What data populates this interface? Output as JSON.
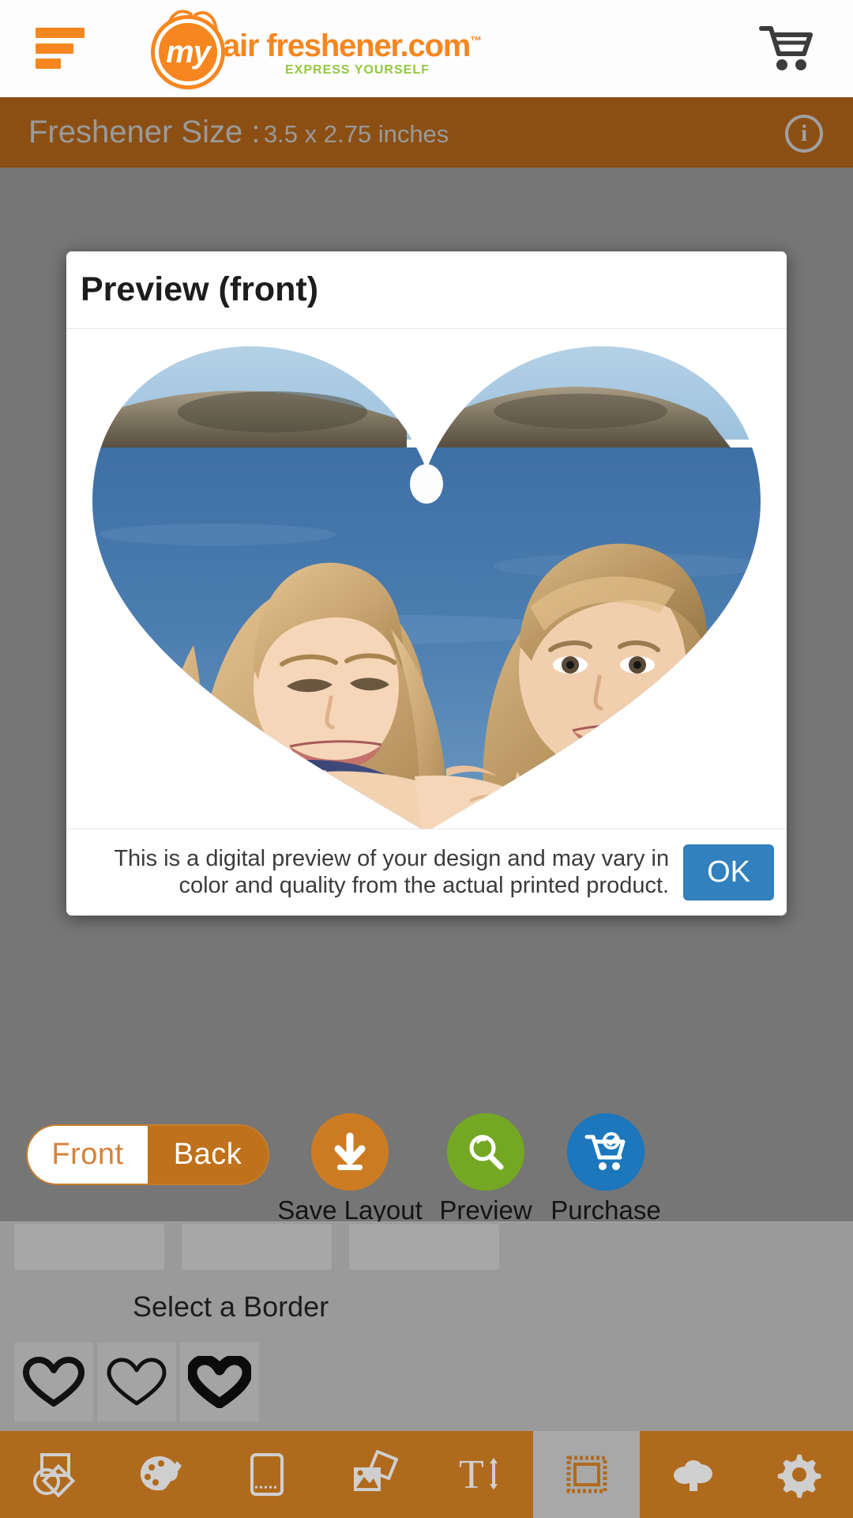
{
  "header": {
    "menu_icon": "hamburger-menu-icon",
    "logo_badge_text": "my",
    "logo_main_text": "air freshener.com",
    "logo_tm": "™",
    "logo_tagline": "EXPRESS YOURSELF",
    "cart_icon": "shopping-cart-icon",
    "brand_orange": "#f6861f",
    "tagline_green": "#93c83e"
  },
  "size_bar": {
    "label": "Freshener Size :",
    "value": "3.5 x 2.75 inches",
    "info_icon": "info-circle-icon",
    "info_glyph": "i",
    "background": "#8b4f14",
    "text_color": "#9a9a9a"
  },
  "modal": {
    "title": "Preview (front)",
    "disclaimer": "This is a digital preview of your design and may vary in color and quality from the actual printed product.",
    "ok_label": "OK",
    "ok_color": "#3280bd",
    "preview_shape": "heart",
    "preview_photo_alt": "mother and daughter at the seaside"
  },
  "actions": {
    "side_toggle": {
      "front_label": "Front",
      "back_label": "Back",
      "selected": "Back",
      "accent": "#c0711b"
    },
    "buttons": [
      {
        "label": "Save Layout",
        "icon": "download-icon",
        "color": "#cd7b22"
      },
      {
        "label": "Preview",
        "icon": "magnifier-icon",
        "color": "#74a723"
      },
      {
        "label": "Purchase",
        "icon": "cart-check-icon",
        "color": "#1c77bd"
      }
    ]
  },
  "border_panel": {
    "title": "Select a Border",
    "swatches": [
      {
        "name": "heart-border-thin",
        "stroke": 9
      },
      {
        "name": "heart-border-medium",
        "stroke": 7
      },
      {
        "name": "heart-border-thick",
        "stroke": 15
      }
    ]
  },
  "bottom_nav": {
    "active_index": 5,
    "items": [
      {
        "name": "shapes-icon",
        "label": "Shapes"
      },
      {
        "name": "palette-icon",
        "label": "Colors"
      },
      {
        "name": "template-icon",
        "label": "Template"
      },
      {
        "name": "images-icon",
        "label": "Images"
      },
      {
        "name": "text-size-icon",
        "label": "Text"
      },
      {
        "name": "border-icon",
        "label": "Border"
      },
      {
        "name": "cloud-upload-icon",
        "label": "Upload"
      },
      {
        "name": "settings-gear-icon",
        "label": "Settings"
      }
    ],
    "background": "#b06a1d",
    "active_background": "#a8a8a8"
  }
}
